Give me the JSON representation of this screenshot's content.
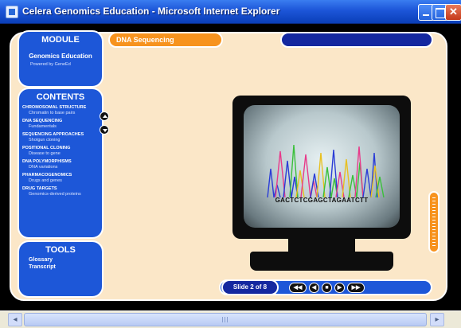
{
  "window": {
    "title": "Celera Genomics Education - Microsoft Internet Explorer"
  },
  "module": {
    "heading": "MODULE",
    "name": "Genomics Education",
    "powered_by": "Powered by GeneEd"
  },
  "contents": {
    "heading": "CONTENTS",
    "items": [
      {
        "title": "CHROMOSOMAL STRUCTURE",
        "sub": "Chromatin to base pairs"
      },
      {
        "title": "DNA SEQUENCING",
        "sub": "Fundamentals"
      },
      {
        "title": "SEQUENCING APPROACHES",
        "sub": "Shotgun cloning"
      },
      {
        "title": "POSITIONAL CLONING",
        "sub": "Disease to gene"
      },
      {
        "title": "DNA POLYMORPHISMS",
        "sub": "DNA variations"
      },
      {
        "title": "PHARMACOGENOMICS",
        "sub": "Drugs and genes"
      },
      {
        "title": "DRUG TARGETS",
        "sub": "Genomics-derived proteins"
      }
    ]
  },
  "tools": {
    "heading": "TOOLS",
    "items": [
      "Glossary",
      "Transcript"
    ]
  },
  "lesson": {
    "title": "DNA Sequencing"
  },
  "screen": {
    "sequence": "GACTCTCGAGCTAGAATCTT"
  },
  "navigation": {
    "slide_counter": "Slide 2 of 8"
  },
  "colors": {
    "panel_blue": "#1d57d8",
    "accent_orange": "#f7931e",
    "stage_cream": "#fbe7c8"
  }
}
